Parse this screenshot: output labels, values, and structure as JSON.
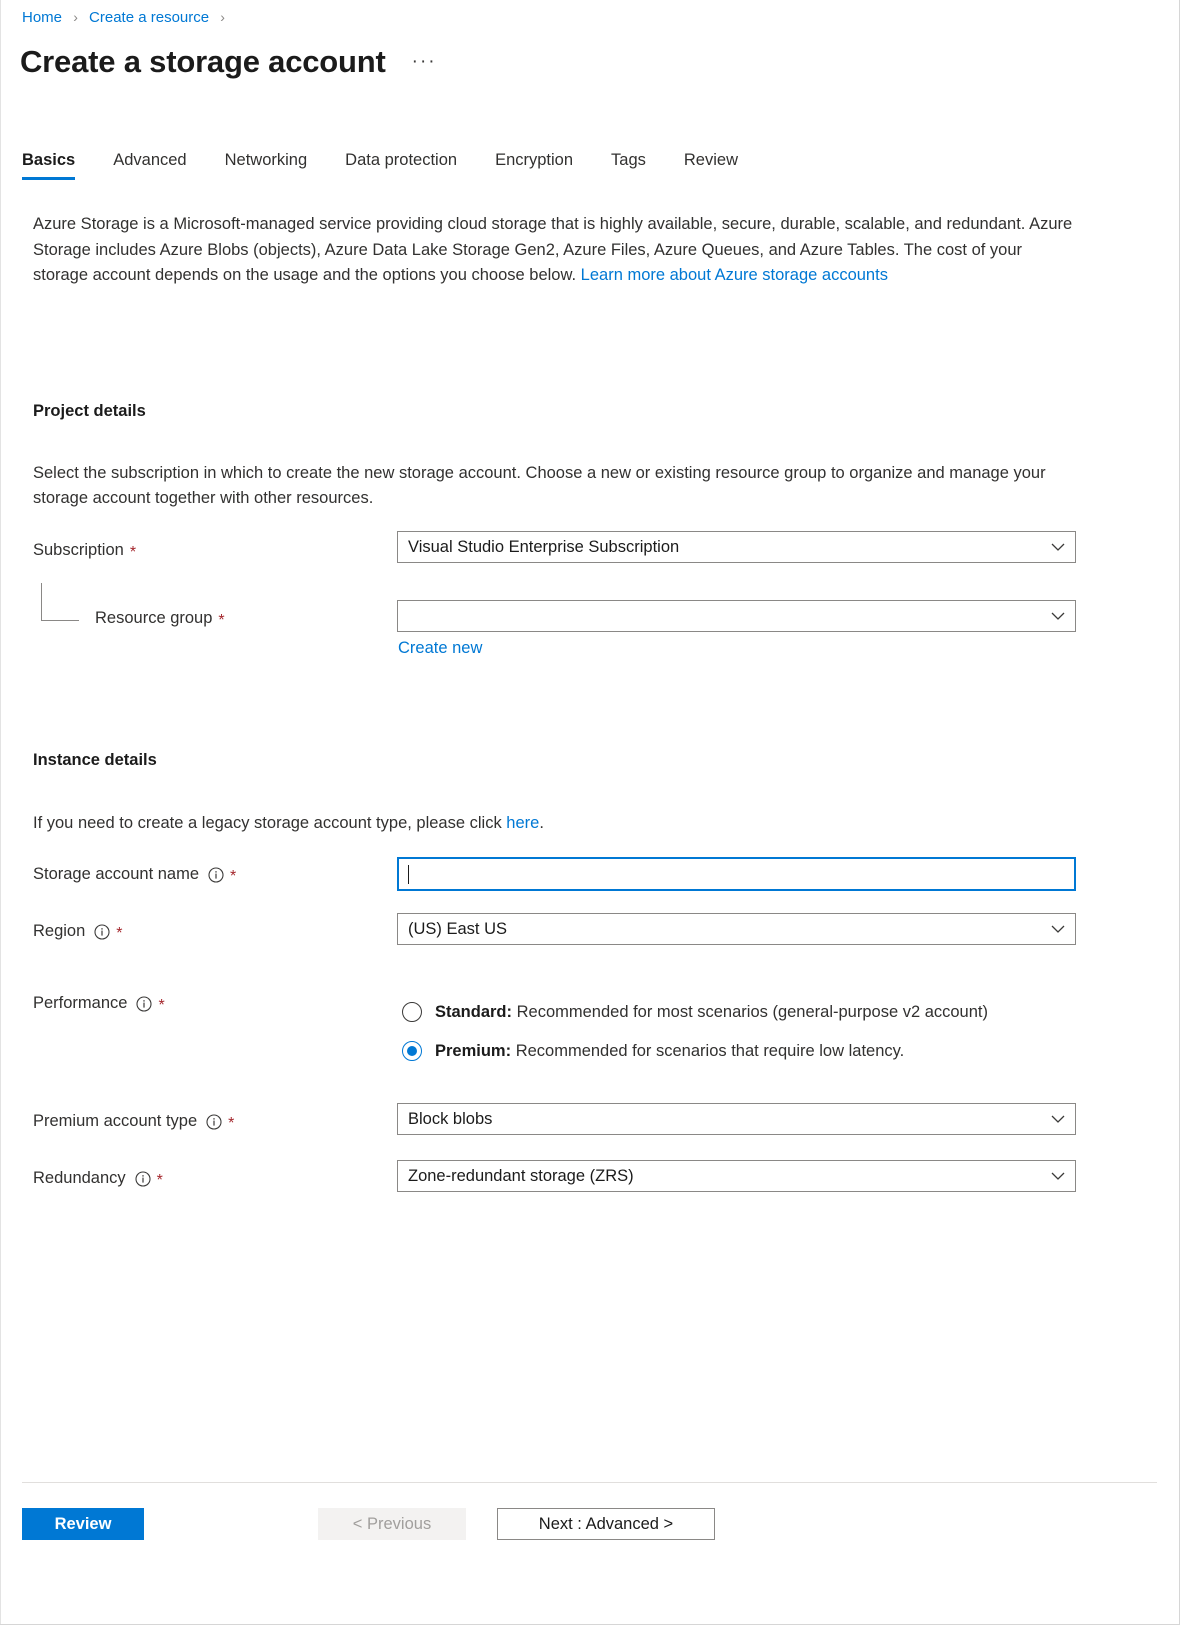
{
  "breadcrumb": {
    "items": [
      "Home",
      "Create a resource"
    ],
    "separator": "›"
  },
  "header": {
    "title": "Create a storage account",
    "more_label": "···"
  },
  "tabs": [
    {
      "label": "Basics",
      "active": true
    },
    {
      "label": "Advanced",
      "active": false
    },
    {
      "label": "Networking",
      "active": false
    },
    {
      "label": "Data protection",
      "active": false
    },
    {
      "label": "Encryption",
      "active": false
    },
    {
      "label": "Tags",
      "active": false
    },
    {
      "label": "Review",
      "active": false
    }
  ],
  "intro": {
    "text_part1": "Azure Storage is a Microsoft-managed service providing cloud storage that is highly available, secure, durable, scalable, and redundant. Azure Storage includes Azure Blobs (objects), Azure Data Lake Storage Gen2, Azure Files, Azure Queues, and Azure Tables. The cost of your storage account depends on the usage and the options you choose below. ",
    "link_text": "Learn more about Azure storage accounts"
  },
  "project_details": {
    "heading": "Project details",
    "description": "Select the subscription in which to create the new storage account. Choose a new or existing resource group to organize and manage your storage account together with other resources.",
    "subscription": {
      "label": "Subscription",
      "required": "*",
      "value": "Visual Studio Enterprise Subscription"
    },
    "resource_group": {
      "label": "Resource group",
      "required": "*",
      "value": "",
      "create_new_label": "Create new"
    }
  },
  "instance_details": {
    "heading": "Instance details",
    "legacy_note_part1": "If you need to create a legacy storage account type, please click ",
    "legacy_note_link": "here",
    "legacy_note_part2": ".",
    "storage_account_name": {
      "label": "Storage account name",
      "required": "*",
      "value": "",
      "placeholder": ""
    },
    "region": {
      "label": "Region",
      "required": "*",
      "value": "(US) East US"
    },
    "performance": {
      "label": "Performance",
      "required": "*",
      "options": [
        {
          "bold": "Standard:",
          "text": " Recommended for most scenarios (general-purpose v2 account)",
          "checked": false
        },
        {
          "bold": "Premium:",
          "text": " Recommended for scenarios that require low latency.",
          "checked": true
        }
      ]
    },
    "premium_account_type": {
      "label": "Premium account type",
      "required": "*",
      "value": "Block blobs"
    },
    "redundancy": {
      "label": "Redundancy",
      "required": "*",
      "value": "Zone-redundant storage (ZRS)"
    }
  },
  "footer": {
    "review_label": "Review",
    "previous_label": "< Previous",
    "next_label": "Next : Advanced >"
  },
  "colors": {
    "accent": "#0078d4",
    "required_asterisk": "#a4262c",
    "text": "#1b1b1b",
    "border": "#8a8886",
    "disabled_bg": "#f3f2f1",
    "disabled_text": "#a19f9d"
  },
  "icons": {
    "info": "info-icon",
    "chevron_down": "chevron-down-icon"
  }
}
